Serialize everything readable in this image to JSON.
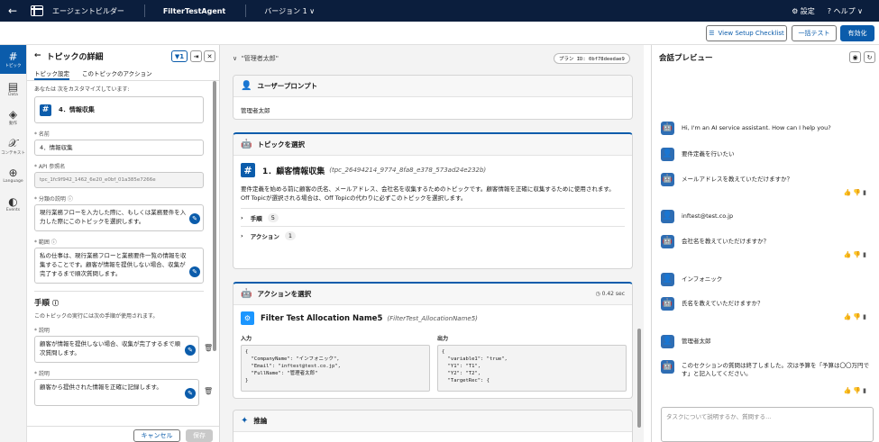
{
  "topbar": {
    "back": "←",
    "title1": "エージェントビルダー",
    "title2": "FilterTestAgent",
    "version": "バージョン 1",
    "version_caret": "∨",
    "settings": "設定",
    "help": "ヘルプ",
    "help_caret": "∨",
    "settings_icon": "⚙",
    "help_icon": "?"
  },
  "toolbar": {
    "setup_checklist": "View Setup Checklist",
    "batch_test": "一括テスト",
    "activate": "有効化"
  },
  "rail": [
    {
      "glyph": "#",
      "label": "トピック",
      "active": true
    },
    {
      "glyph": "▤",
      "label": "Data"
    },
    {
      "glyph": "◈",
      "label": "動作"
    },
    {
      "glyph": "𝒳",
      "label": "コンテキスト"
    },
    {
      "glyph": "⊕",
      "label": "Language"
    },
    {
      "glyph": "◐",
      "label": "Events"
    }
  ],
  "left": {
    "title": "トピックの詳細",
    "filter_count": "1",
    "tab1": "トピック設定",
    "tab2": "このトピックのアクション",
    "customizing": "あなたは 次をカスタマイズしています:",
    "topic_name": "4．情報収集",
    "name_label": "* 名前",
    "name_value": "4．情報収集",
    "api_label": "* API 参照名",
    "api_value": "tpc_1fc9f942_1462_6e20_e0bf_01a385e7266e",
    "class_label": "* 分類の説明",
    "class_value": "現行業務フローを入力した際に、もしくは業務要件を入力した際にこのトピックを選択します。",
    "scope_label": "* 範囲",
    "scope_value": "私の仕事は、現行業務フローと業務要件一覧の情報を収集することです。顧客が情報を提供しない場合、収集が完了するまで順次質問します。",
    "steps_title": "手順",
    "steps_desc": "このトピックの実行には次の手順が使用されます。",
    "step1_label": "* 説明",
    "step1_value": "顧客が情報を提供しない場合、収集が完了するまで順次質問します。",
    "step2_label": "* 説明",
    "step2_value": "顧客から提供された情報を正確に記録します。",
    "cancel": "キャンセル",
    "save": "保存"
  },
  "mid": {
    "thread_title": "\"管理者太郎\"",
    "plan_id": "プラン ID: 0bf78deedae9",
    "user_prompt_title": "ユーザープロンプト",
    "user_prompt": "管理者太郎",
    "topic_select_title": "トピックを選択",
    "topic_name": "1．顧客情報収集",
    "topic_api": "(tpc_26494214_9774_8fa8_e378_573ad24e232b)",
    "topic_desc": "要件定義を始める前に顧客の氏名、メールアドレス、会社名を収集するためのトピックです。顧客情報を正確に収集するために使用されます。",
    "topic_note": "Off Topicが選択される場合は、Off Topicの代わりに必ずこのトピックを選択します。",
    "steps_label": "手順",
    "steps_count": "5",
    "actions_label": "アクション",
    "actions_count": "1",
    "action_select_title": "アクションを選択",
    "action_time": "0.42 sec",
    "action_name": "Filter Test Allocation Name5",
    "action_api": "(FilterTest_AllocationName5)",
    "input_label": "入力",
    "output_label": "出力",
    "input_code": "{\n  \"CompanyName\": \"インフォニック\",\n  \"Email\": \"inftest@test.co.jp\",\n  \"FullName\": \"管理者太郎\"\n}",
    "output_code": "{\n  \"variable1\": \"true\",\n  \"Y1\": \"T1\",\n  \"Y2\": \"T2\",\n  \"TargetRec\": {",
    "reasoning_title": "推論"
  },
  "chat": {
    "title": "会話プレビュー",
    "placeholder": "タスクについて説明するか、質問する...",
    "messages": [
      {
        "role": "agent",
        "text": "Hi, I'm an AI service assistant. How can I help you?"
      },
      {
        "role": "user",
        "text": "要件定義を行いたい"
      },
      {
        "role": "agent",
        "text": "メールアドレスを教えていただけますか？",
        "fb": true
      },
      {
        "role": "user",
        "text": "inftest@test.co.jp"
      },
      {
        "role": "agent",
        "text": "会社名を教えていただけますか？",
        "fb": true
      },
      {
        "role": "user",
        "text": "インフォニック"
      },
      {
        "role": "agent",
        "text": "氏名を教えていただけますか？",
        "fb": true
      },
      {
        "role": "user",
        "text": "管理者太郎"
      },
      {
        "role": "agent",
        "text": "このセクションの質問は終了しました。次は予算を「予算は〇〇万円です」と記入してください。",
        "fb": true
      }
    ],
    "feedback": "👍👎▮"
  },
  "colors": {
    "brand": "#0b5cab",
    "header": "#0b1e3d"
  }
}
